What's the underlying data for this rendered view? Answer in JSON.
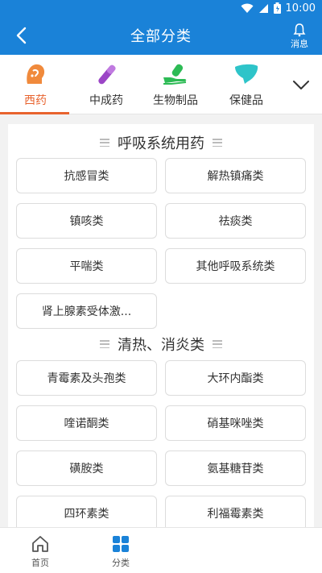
{
  "status": {
    "time": "10:00"
  },
  "header": {
    "title": "全部分类",
    "message_label": "消息"
  },
  "categories": [
    {
      "label": "西药",
      "icon": "head-icon",
      "active": true
    },
    {
      "label": "中成药",
      "icon": "pill-icon",
      "active": false
    },
    {
      "label": "生物制品",
      "icon": "hand-medicine-icon",
      "active": false
    },
    {
      "label": "保健品",
      "icon": "liver-icon",
      "active": false
    }
  ],
  "sections": [
    {
      "title": "呼吸系统用药",
      "items": [
        "抗感冒类",
        "解热镇痛类",
        "镇咳类",
        "祛痰类",
        "平喘类",
        "其他呼吸系统类",
        "肾上腺素受体激..."
      ]
    },
    {
      "title": "清热、消炎类",
      "items": [
        "青霉素及头孢类",
        "大环内酯类",
        "喹诺酮类",
        "硝基咪唑类",
        "磺胺类",
        "氨基糖苷类",
        "四环素类",
        "利福霉素类"
      ]
    }
  ],
  "bottom_nav": [
    {
      "label": "首页",
      "icon": "home-icon"
    },
    {
      "label": "分类",
      "icon": "category-grid-icon"
    }
  ],
  "colors": {
    "primary": "#1a82d8",
    "accent": "#e8632e"
  }
}
